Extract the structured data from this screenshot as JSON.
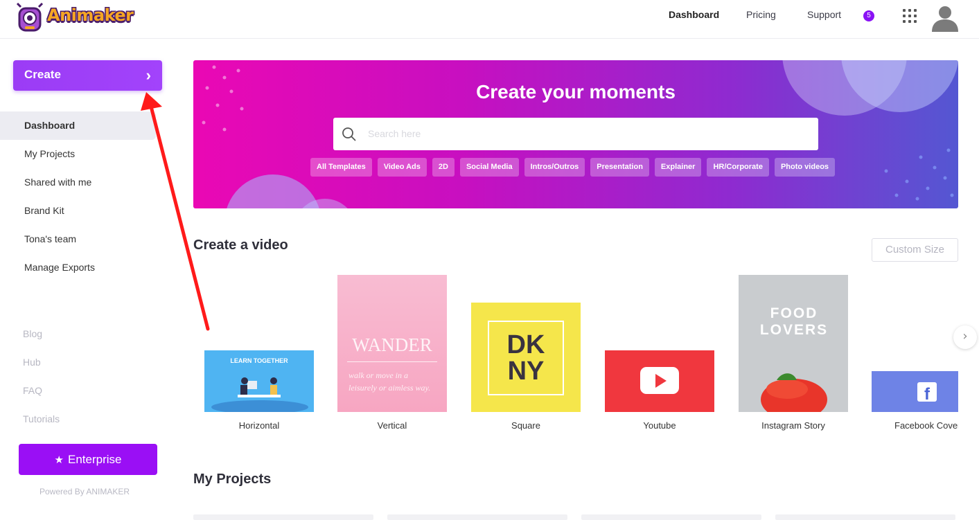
{
  "app": {
    "logo_text": "Animaker"
  },
  "nav": {
    "dashboard": "Dashboard",
    "pricing": "Pricing",
    "support": "Support",
    "notification_count": "5"
  },
  "sidebar": {
    "create_label": "Create",
    "items": [
      {
        "label": "Dashboard",
        "active": true
      },
      {
        "label": "My Projects"
      },
      {
        "label": "Shared with me"
      },
      {
        "label": "Brand Kit"
      },
      {
        "label": "Tona's team"
      },
      {
        "label": "Manage Exports"
      }
    ],
    "links": [
      "Blog",
      "Hub",
      "FAQ",
      "Tutorials"
    ],
    "enterprise_label": "Enterprise",
    "powered_by": "Powered By ANIMAKER"
  },
  "hero": {
    "title": "Create your moments",
    "search_placeholder": "Search here",
    "chips": [
      "All Templates",
      "Video Ads",
      "2D",
      "Social Media",
      "Intros/Outros",
      "Presentation",
      "Explainer",
      "HR/Corporate",
      "Photo videos"
    ]
  },
  "create_video": {
    "title": "Create a video",
    "custom_size_label": "Custom Size",
    "formats": [
      {
        "label": "Horizontal",
        "thumb_text": "LEARN TOGETHER"
      },
      {
        "label": "Vertical",
        "thumb_text": "WANDER",
        "thumb_sub": "walk or move in a leisurely or aimless way."
      },
      {
        "label": "Square",
        "thumb_text": "DK NY"
      },
      {
        "label": "Youtube"
      },
      {
        "label": "Instagram Story",
        "thumb_text": "FOOD LOVERS"
      },
      {
        "label": "Facebook Cover"
      }
    ]
  },
  "my_projects": {
    "title": "My Projects"
  },
  "colors": {
    "accent": "#9a0ff5",
    "annotation_arrow": "#ff1a1a"
  }
}
